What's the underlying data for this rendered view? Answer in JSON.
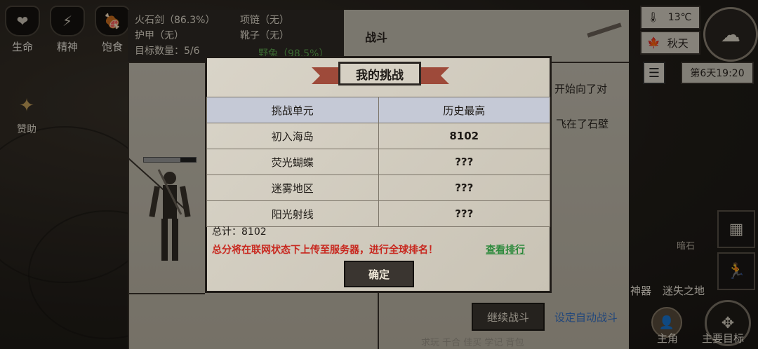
{
  "stats": [
    {
      "label": "生命",
      "icon": "heart-icon",
      "glyph": "❤"
    },
    {
      "label": "精神",
      "icon": "lightning-icon",
      "glyph": "⚡"
    },
    {
      "label": "饱食",
      "icon": "food-icon",
      "glyph": "🍖"
    }
  ],
  "sponsor": {
    "label": "赞助",
    "icon": "treasure-icon",
    "glyph": "✦"
  },
  "equipment": {
    "weapon": "火石剑（86.3%）",
    "armor": "护甲（无）",
    "target": "目标数量：5/6",
    "necklace": "项链（无）",
    "boots": "靴子（无）",
    "extra": "野兔（98.5%）"
  },
  "battle": {
    "title": "战斗",
    "log_line1": "开始向了对",
    "log_line2": "飞在了石壁",
    "continue_button": "继续战斗",
    "auto_link": "设定自动战斗"
  },
  "bottom_tabs": "求玩    千合    佳买    学记    背包",
  "hud": {
    "temperature": "13℃",
    "season": "秋天",
    "menu_glyph": "☰",
    "day_time": "第6天19:20",
    "weather_icon": "cloud-icon",
    "map_label_1": "神器",
    "map_label_2": "迷失之地",
    "map_label_3": "暗石",
    "hero_label": "主角",
    "goal_label": "主要目标"
  },
  "modal": {
    "title": "我的挑战",
    "headers": [
      "挑战单元",
      "历史最高"
    ],
    "rows": [
      {
        "unit": "初入海岛",
        "best": "8102"
      },
      {
        "unit": "荧光蝴蝶",
        "best": "???"
      },
      {
        "unit": "迷雾地区",
        "best": "???"
      },
      {
        "unit": "阳光射线",
        "best": "???"
      }
    ],
    "total": "总计：8102",
    "notice": "总分将在联网状态下上传至服务器，进行全球排名！",
    "rank_link": "查看排行",
    "confirm": "确定"
  }
}
